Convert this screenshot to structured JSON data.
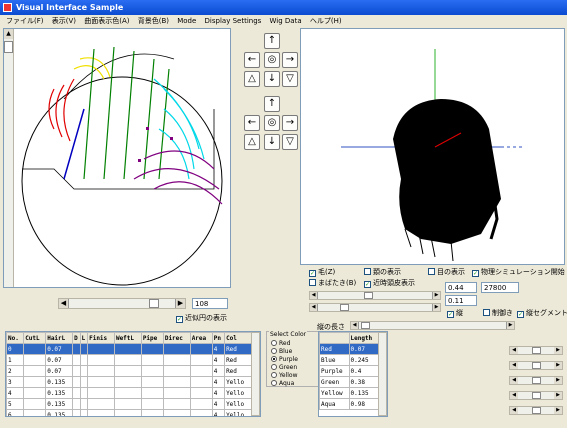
{
  "window": {
    "title": "Visual Interface Sample"
  },
  "menu": [
    "ファイル(F)",
    "表示(V)",
    "曲面表示色(A)",
    "背景色(B)",
    "Mode",
    "Display Settings",
    "Wig Data",
    "ヘルプ(H)"
  ],
  "nav_buttons": {
    "up": "↑",
    "left": "←",
    "center": "◎",
    "right": "→",
    "tri_up": "△",
    "down": "↓",
    "tri_down": "▽"
  },
  "slider_value": "108",
  "checkboxes": {
    "hair": {
      "label": "毛(Z)",
      "checked": true
    },
    "eyelash": {
      "label": "まばたき(B)",
      "checked": false
    },
    "neck_show": {
      "label": "頚の表示",
      "checked": false
    },
    "proximity": {
      "label": "近時頭皮表示",
      "checked": true
    },
    "eye_show": {
      "label": "目の表示",
      "checked": false
    },
    "physics": {
      "label": "物理シミュレーション開始",
      "checked": true
    },
    "circle_show": {
      "label": "近似円の表示",
      "checked": true
    },
    "tate": {
      "label": "縦",
      "checked": true
    },
    "brush": {
      "label": "制御き",
      "checked": false
    },
    "segment": {
      "label": "縦セグメント",
      "checked": true
    }
  },
  "fields": {
    "val_a": "0.44",
    "val_b": "27800",
    "val_c": "0.11"
  },
  "length_label": "縦の長さ",
  "select_color": {
    "title": "Select Color",
    "options": [
      "Red",
      "Blue",
      "Purple",
      "Green",
      "Yellow",
      "Aqua"
    ],
    "selected": "Purple"
  },
  "hair_table": {
    "columns": [
      "No.",
      "CutL",
      "HairL",
      "D",
      "L",
      "Finis",
      "WeftL",
      "Pipe",
      "Direc",
      "Area",
      "Pn",
      "Col"
    ],
    "rows": [
      [
        "0",
        "",
        "0.07",
        "",
        "",
        "",
        "",
        "",
        "",
        "",
        "4",
        "Red"
      ],
      [
        "1",
        "",
        "0.07",
        "",
        "",
        "",
        "",
        "",
        "",
        "",
        "4",
        "Red"
      ],
      [
        "2",
        "",
        "0.07",
        "",
        "",
        "",
        "",
        "",
        "",
        "",
        "4",
        "Red"
      ],
      [
        "3",
        "",
        "0.135",
        "",
        "",
        "",
        "",
        "",
        "",
        "",
        "4",
        "Yello"
      ],
      [
        "4",
        "",
        "0.135",
        "",
        "",
        "",
        "",
        "",
        "",
        "",
        "4",
        "Yello"
      ],
      [
        "5",
        "",
        "0.135",
        "",
        "",
        "",
        "",
        "",
        "",
        "",
        "4",
        "Yello"
      ],
      [
        "6",
        "",
        "0.135",
        "",
        "",
        "",
        "",
        "",
        "",
        "",
        "4",
        "Yello"
      ]
    ],
    "selected_row": 0
  },
  "length_table": {
    "columns": [
      "",
      "Length"
    ],
    "rows": [
      [
        "Red",
        "0.07"
      ],
      [
        "Blue",
        "0.245"
      ],
      [
        "Purple",
        "0.4"
      ],
      [
        "Green",
        "0.38"
      ],
      [
        "Yellow",
        "0.135"
      ],
      [
        "Aqua",
        "0.98"
      ]
    ],
    "selected_row": 0
  },
  "colors": {
    "titlebar": "#0a4bd0",
    "red": "#e00000",
    "yellow": "#f0e000",
    "green": "#008000",
    "aqua": "#00d8e8",
    "purple": "#800080",
    "blue": "#0000c0",
    "select": "#316ac5"
  }
}
